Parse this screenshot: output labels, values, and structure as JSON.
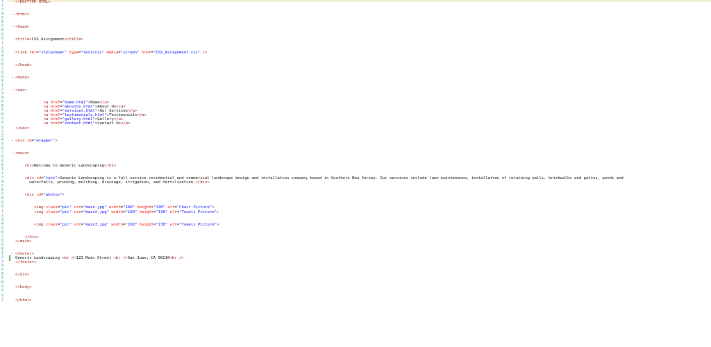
{
  "editor": {
    "lines": [
      {
        "tokens": [
          [
            "t",
            "<!DOCTYPE HTML>"
          ]
        ]
      },
      {
        "tokens": []
      },
      {
        "tokens": []
      },
      {
        "fold": true,
        "tokens": [
          [
            "t",
            "<html>"
          ]
        ]
      },
      {
        "tokens": []
      },
      {
        "tokens": []
      },
      {
        "fold": true,
        "tokens": [
          [
            "t",
            "<head>"
          ]
        ]
      },
      {
        "tokens": []
      },
      {
        "tokens": []
      },
      {
        "tokens": [
          [
            "t",
            "<title>"
          ],
          [
            "p",
            "CSS Assignment"
          ],
          [
            "t",
            "</title>"
          ]
        ]
      },
      {
        "tokens": []
      },
      {
        "tokens": []
      },
      {
        "tokens": [
          [
            "t",
            "<link "
          ],
          [
            "a",
            "rel"
          ],
          [
            "p",
            "="
          ],
          [
            "v",
            "\"stylesheet\""
          ],
          [
            "p",
            " "
          ],
          [
            "a",
            "type"
          ],
          [
            "p",
            "="
          ],
          [
            "v",
            "\"text/css\""
          ],
          [
            "p",
            " "
          ],
          [
            "a",
            "media"
          ],
          [
            "p",
            "="
          ],
          [
            "v",
            "\"screen\""
          ],
          [
            "p",
            " "
          ],
          [
            "a",
            "href"
          ],
          [
            "p",
            "="
          ],
          [
            "v",
            "\"CSS_Assignment.css\""
          ],
          [
            "p",
            " "
          ],
          [
            "t",
            "/>"
          ]
        ]
      },
      {
        "tokens": []
      },
      {
        "tokens": []
      },
      {
        "tokens": [
          [
            "t",
            "</head>"
          ]
        ]
      },
      {
        "tokens": []
      },
      {
        "tokens": []
      },
      {
        "fold": true,
        "tokens": [
          [
            "t",
            "<body>"
          ]
        ]
      },
      {
        "tokens": []
      },
      {
        "tokens": []
      },
      {
        "fold": true,
        "tokens": [
          [
            "t",
            "<nav>"
          ]
        ]
      },
      {
        "tokens": []
      },
      {
        "tokens": []
      },
      {
        "indent": 6,
        "tokens": [
          [
            "t",
            "<a "
          ],
          [
            "a",
            "href"
          ],
          [
            "p",
            "="
          ],
          [
            "v",
            "\"home.html\""
          ],
          [
            "t",
            ">"
          ],
          [
            "p",
            "Home"
          ],
          [
            "t",
            "</a>"
          ]
        ]
      },
      {
        "indent": 6,
        "tokens": [
          [
            "t",
            "<a "
          ],
          [
            "a",
            "href"
          ],
          [
            "p",
            "="
          ],
          [
            "v",
            "\"aboutUs.html\""
          ],
          [
            "t",
            ">"
          ],
          [
            "p",
            "About Us"
          ],
          [
            "t",
            "</a>"
          ]
        ]
      },
      {
        "indent": 6,
        "tokens": [
          [
            "t",
            "<a "
          ],
          [
            "a",
            "href"
          ],
          [
            "p",
            "="
          ],
          [
            "v",
            "\"services.html\""
          ],
          [
            "t",
            ">"
          ],
          [
            "p",
            "Our Services"
          ],
          [
            "t",
            "</a>"
          ]
        ]
      },
      {
        "indent": 6,
        "tokens": [
          [
            "t",
            "<a "
          ],
          [
            "a",
            "href"
          ],
          [
            "p",
            "="
          ],
          [
            "v",
            "\"testimonials.html\""
          ],
          [
            "t",
            ">"
          ],
          [
            "p",
            "Testimonials"
          ],
          [
            "t",
            "</a>"
          ]
        ]
      },
      {
        "indent": 6,
        "tokens": [
          [
            "t",
            "<a "
          ],
          [
            "a",
            "href"
          ],
          [
            "p",
            "="
          ],
          [
            "v",
            "\"gallery.html\""
          ],
          [
            "t",
            ">"
          ],
          [
            "p",
            "Gallery"
          ],
          [
            "t",
            "</a>"
          ]
        ]
      },
      {
        "indent": 6,
        "tokens": [
          [
            "t",
            "<a "
          ],
          [
            "a",
            "href"
          ],
          [
            "p",
            "="
          ],
          [
            "v",
            "\"contact.html\""
          ],
          [
            "t",
            ">"
          ],
          [
            "p",
            "Contact Us"
          ],
          [
            "t",
            "</a>"
          ]
        ]
      },
      {
        "tokens": [
          [
            "t",
            "</nav>"
          ]
        ]
      },
      {
        "tokens": []
      },
      {
        "tokens": []
      },
      {
        "fold": true,
        "tokens": [
          [
            "t",
            "<div "
          ],
          [
            "a",
            "id"
          ],
          [
            "p",
            "="
          ],
          [
            "v",
            "\"wrapper\""
          ],
          [
            "t",
            ">"
          ]
        ]
      },
      {
        "tokens": []
      },
      {
        "tokens": []
      },
      {
        "fold": true,
        "tokens": [
          [
            "t",
            "<main>"
          ]
        ]
      },
      {
        "tokens": []
      },
      {
        "tokens": []
      },
      {
        "indent": 2,
        "tokens": [
          [
            "t",
            "<h1>"
          ],
          [
            "p",
            "Welcome to Generic Landscaping"
          ],
          [
            "t",
            "</h1>"
          ]
        ]
      },
      {
        "tokens": []
      },
      {
        "tokens": []
      },
      {
        "indent": 2,
        "tokens": [
          [
            "t",
            "<div "
          ],
          [
            "a",
            "id"
          ],
          [
            "p",
            "="
          ],
          [
            "v",
            "\"text\""
          ],
          [
            "t",
            ">"
          ],
          [
            "p",
            "Generic Landscaping is a full-service residential and commercial landscape design and installation company based in Southern New Jersey. Our services include lawn maintenance, installation of retaining walls, brickwalks and patios, ponds and"
          ]
        ]
      },
      {
        "indent": 3,
        "tokens": [
          [
            "p",
            "waterfalls, pruning, mulching, drainage, irrigation, and fertilization."
          ],
          [
            "t",
            "</div>"
          ]
        ]
      },
      {
        "tokens": []
      },
      {
        "tokens": []
      },
      {
        "indent": 2,
        "tokens": [
          [
            "t",
            "<div "
          ],
          [
            "a",
            "id"
          ],
          [
            "p",
            "="
          ],
          [
            "v",
            "\"photos\""
          ],
          [
            "t",
            ">"
          ]
        ]
      },
      {
        "tokens": []
      },
      {
        "tokens": []
      },
      {
        "indent": 4,
        "tokens": [
          [
            "t",
            "<img "
          ],
          [
            "a",
            "class"
          ],
          [
            "p",
            "="
          ],
          [
            "v",
            "\"pic\""
          ],
          [
            "p",
            " "
          ],
          [
            "a",
            "src"
          ],
          [
            "p",
            "="
          ],
          [
            "v",
            "\"main.jpg\""
          ],
          [
            "p",
            " "
          ],
          [
            "a",
            "width"
          ],
          [
            "p",
            "="
          ],
          [
            "v",
            "\"160\""
          ],
          [
            "p",
            " "
          ],
          [
            "a",
            "height"
          ],
          [
            "p",
            "="
          ],
          [
            "v",
            "\"130\""
          ],
          [
            "p",
            " "
          ],
          [
            "a",
            "alt"
          ],
          [
            "p",
            "="
          ],
          [
            "v",
            "\"Chair Picture\""
          ],
          [
            "t",
            ">"
          ]
        ]
      },
      {
        "indent": 4,
        "tokens": [
          [
            "t",
            "<img "
          ],
          [
            "a",
            "class"
          ],
          [
            "p",
            "="
          ],
          [
            "v",
            "\"pic\""
          ],
          [
            "p",
            " "
          ],
          [
            "a",
            "src"
          ],
          [
            "p",
            "="
          ],
          [
            "v",
            "\"main2.jpg\""
          ],
          [
            "p",
            " "
          ],
          [
            "a",
            "width"
          ],
          [
            "p",
            "="
          ],
          [
            "v",
            "\"160\""
          ],
          [
            "p",
            " "
          ],
          [
            "a",
            "height"
          ],
          [
            "p",
            "="
          ],
          [
            "v",
            "\"130\""
          ],
          [
            "p",
            " "
          ],
          [
            "a",
            "alt"
          ],
          [
            "p",
            "="
          ],
          [
            "v",
            "\"Towels Picture\""
          ],
          [
            "t",
            ">"
          ]
        ]
      },
      {
        "tokens": []
      },
      {
        "tokens": []
      },
      {
        "indent": 4,
        "tokens": [
          [
            "t",
            "<img "
          ],
          [
            "a",
            "class"
          ],
          [
            "p",
            "="
          ],
          [
            "v",
            "\"pic\""
          ],
          [
            "p",
            " "
          ],
          [
            "a",
            "src"
          ],
          [
            "p",
            "="
          ],
          [
            "v",
            "\"main3.jpg\""
          ],
          [
            "p",
            " "
          ],
          [
            "a",
            "width"
          ],
          [
            "p",
            "="
          ],
          [
            "v",
            "\"160\""
          ],
          [
            "p",
            " "
          ],
          [
            "a",
            "height"
          ],
          [
            "p",
            "="
          ],
          [
            "v",
            "\"130\""
          ],
          [
            "p",
            " "
          ],
          [
            "a",
            "alt"
          ],
          [
            "p",
            "="
          ],
          [
            "v",
            "\"Towels Picture\""
          ],
          [
            "t",
            ">"
          ]
        ]
      },
      {
        "tokens": []
      },
      {
        "tokens": []
      },
      {
        "indent": 2,
        "tokens": [
          [
            "t",
            "</div>"
          ]
        ]
      },
      {
        "tokens": [
          [
            "t",
            "</main>"
          ]
        ]
      },
      {
        "tokens": []
      },
      {
        "tokens": []
      },
      {
        "fold": true,
        "tokens": [
          [
            "t",
            "<footer>"
          ]
        ]
      },
      {
        "mark": true,
        "tokens": [
          [
            "p",
            "Generic Landscaping "
          ],
          [
            "t",
            "<br />"
          ],
          [
            "p",
            "123 Main Street "
          ],
          [
            "t",
            "<br />"
          ],
          [
            "p",
            "San Juan, CA 90210"
          ],
          [
            "t",
            "<br />"
          ]
        ]
      },
      {
        "tokens": [
          [
            "t",
            "</footer>"
          ]
        ]
      },
      {
        "tokens": []
      },
      {
        "tokens": []
      },
      {
        "tokens": [
          [
            "t",
            "</div>"
          ]
        ]
      },
      {
        "tokens": []
      },
      {
        "tokens": []
      },
      {
        "tokens": [
          [
            "t",
            "</body>"
          ]
        ]
      },
      {
        "tokens": []
      },
      {
        "tokens": []
      },
      {
        "tokens": [
          [
            "t",
            "</html>"
          ]
        ]
      }
    ]
  }
}
